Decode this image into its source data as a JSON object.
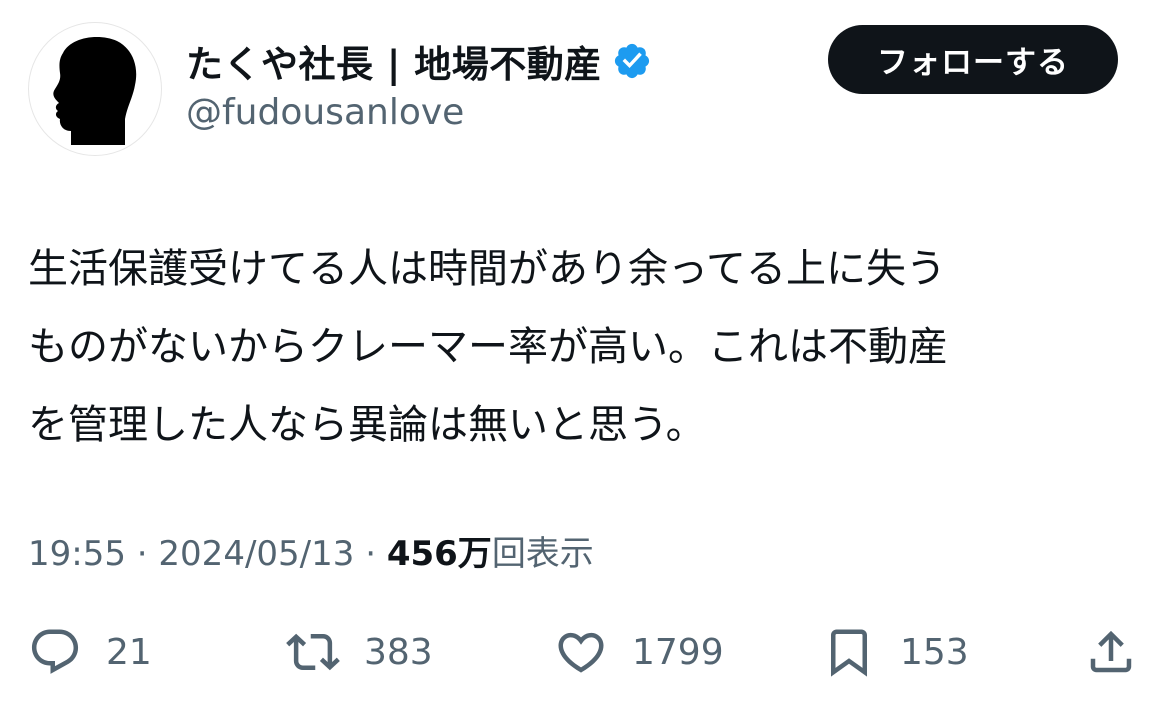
{
  "user": {
    "display_name": "たくや社長 | 地場不動産",
    "handle": "@fudousanlove",
    "verified_icon": "verified-badge-icon",
    "verified_color": "#1d9bf0"
  },
  "follow_button": {
    "label": "フォローする"
  },
  "tweet": {
    "text": "生活保護受けてる人は時間があり余ってる上に失う\nものがないからクレーマー率が高い。これは不動産\nを管理した人なら異論は無いと思う。"
  },
  "meta": {
    "time": "19:55",
    "separator": " · ",
    "date": "2024/05/13",
    "views_count": "456万",
    "views_label": "回表示"
  },
  "actions": {
    "reply": {
      "icon": "reply-icon",
      "count": "21"
    },
    "retweet": {
      "icon": "retweet-icon",
      "count": "383"
    },
    "like": {
      "icon": "heart-icon",
      "count": "1799"
    },
    "bookmark": {
      "icon": "bookmark-icon",
      "count": "153"
    },
    "share": {
      "icon": "share-icon"
    }
  },
  "colors": {
    "text_primary": "#0f1419",
    "text_secondary": "#536471",
    "button_bg": "#0f1419",
    "button_text": "#ffffff"
  }
}
